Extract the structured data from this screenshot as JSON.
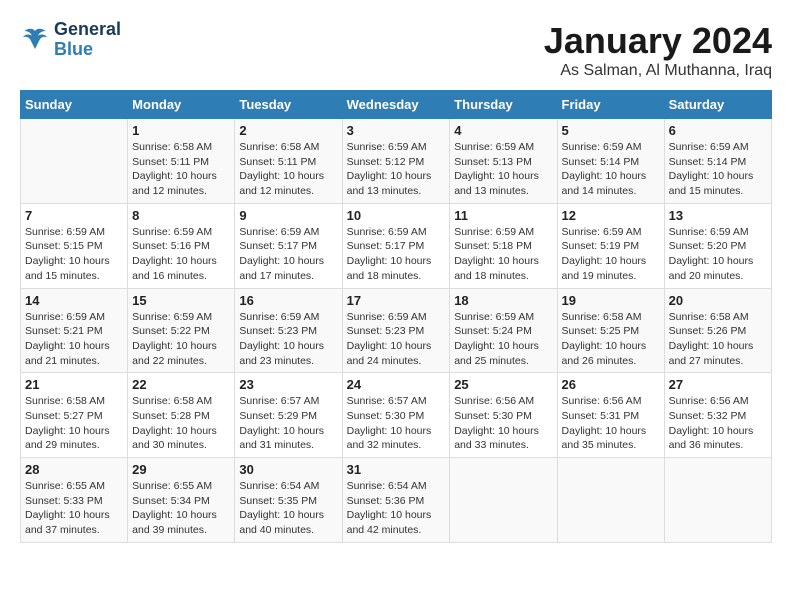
{
  "header": {
    "logo_line1": "General",
    "logo_line2": "Blue",
    "month": "January 2024",
    "location": "As Salman, Al Muthanna, Iraq"
  },
  "weekdays": [
    "Sunday",
    "Monday",
    "Tuesday",
    "Wednesday",
    "Thursday",
    "Friday",
    "Saturday"
  ],
  "weeks": [
    [
      {
        "day": "",
        "info": ""
      },
      {
        "day": "1",
        "info": "Sunrise: 6:58 AM\nSunset: 5:11 PM\nDaylight: 10 hours\nand 12 minutes."
      },
      {
        "day": "2",
        "info": "Sunrise: 6:58 AM\nSunset: 5:11 PM\nDaylight: 10 hours\nand 12 minutes."
      },
      {
        "day": "3",
        "info": "Sunrise: 6:59 AM\nSunset: 5:12 PM\nDaylight: 10 hours\nand 13 minutes."
      },
      {
        "day": "4",
        "info": "Sunrise: 6:59 AM\nSunset: 5:13 PM\nDaylight: 10 hours\nand 13 minutes."
      },
      {
        "day": "5",
        "info": "Sunrise: 6:59 AM\nSunset: 5:14 PM\nDaylight: 10 hours\nand 14 minutes."
      },
      {
        "day": "6",
        "info": "Sunrise: 6:59 AM\nSunset: 5:14 PM\nDaylight: 10 hours\nand 15 minutes."
      }
    ],
    [
      {
        "day": "7",
        "info": "Sunrise: 6:59 AM\nSunset: 5:15 PM\nDaylight: 10 hours\nand 15 minutes."
      },
      {
        "day": "8",
        "info": "Sunrise: 6:59 AM\nSunset: 5:16 PM\nDaylight: 10 hours\nand 16 minutes."
      },
      {
        "day": "9",
        "info": "Sunrise: 6:59 AM\nSunset: 5:17 PM\nDaylight: 10 hours\nand 17 minutes."
      },
      {
        "day": "10",
        "info": "Sunrise: 6:59 AM\nSunset: 5:17 PM\nDaylight: 10 hours\nand 18 minutes."
      },
      {
        "day": "11",
        "info": "Sunrise: 6:59 AM\nSunset: 5:18 PM\nDaylight: 10 hours\nand 18 minutes."
      },
      {
        "day": "12",
        "info": "Sunrise: 6:59 AM\nSunset: 5:19 PM\nDaylight: 10 hours\nand 19 minutes."
      },
      {
        "day": "13",
        "info": "Sunrise: 6:59 AM\nSunset: 5:20 PM\nDaylight: 10 hours\nand 20 minutes."
      }
    ],
    [
      {
        "day": "14",
        "info": "Sunrise: 6:59 AM\nSunset: 5:21 PM\nDaylight: 10 hours\nand 21 minutes."
      },
      {
        "day": "15",
        "info": "Sunrise: 6:59 AM\nSunset: 5:22 PM\nDaylight: 10 hours\nand 22 minutes."
      },
      {
        "day": "16",
        "info": "Sunrise: 6:59 AM\nSunset: 5:23 PM\nDaylight: 10 hours\nand 23 minutes."
      },
      {
        "day": "17",
        "info": "Sunrise: 6:59 AM\nSunset: 5:23 PM\nDaylight: 10 hours\nand 24 minutes."
      },
      {
        "day": "18",
        "info": "Sunrise: 6:59 AM\nSunset: 5:24 PM\nDaylight: 10 hours\nand 25 minutes."
      },
      {
        "day": "19",
        "info": "Sunrise: 6:58 AM\nSunset: 5:25 PM\nDaylight: 10 hours\nand 26 minutes."
      },
      {
        "day": "20",
        "info": "Sunrise: 6:58 AM\nSunset: 5:26 PM\nDaylight: 10 hours\nand 27 minutes."
      }
    ],
    [
      {
        "day": "21",
        "info": "Sunrise: 6:58 AM\nSunset: 5:27 PM\nDaylight: 10 hours\nand 29 minutes."
      },
      {
        "day": "22",
        "info": "Sunrise: 6:58 AM\nSunset: 5:28 PM\nDaylight: 10 hours\nand 30 minutes."
      },
      {
        "day": "23",
        "info": "Sunrise: 6:57 AM\nSunset: 5:29 PM\nDaylight: 10 hours\nand 31 minutes."
      },
      {
        "day": "24",
        "info": "Sunrise: 6:57 AM\nSunset: 5:30 PM\nDaylight: 10 hours\nand 32 minutes."
      },
      {
        "day": "25",
        "info": "Sunrise: 6:56 AM\nSunset: 5:30 PM\nDaylight: 10 hours\nand 33 minutes."
      },
      {
        "day": "26",
        "info": "Sunrise: 6:56 AM\nSunset: 5:31 PM\nDaylight: 10 hours\nand 35 minutes."
      },
      {
        "day": "27",
        "info": "Sunrise: 6:56 AM\nSunset: 5:32 PM\nDaylight: 10 hours\nand 36 minutes."
      }
    ],
    [
      {
        "day": "28",
        "info": "Sunrise: 6:55 AM\nSunset: 5:33 PM\nDaylight: 10 hours\nand 37 minutes."
      },
      {
        "day": "29",
        "info": "Sunrise: 6:55 AM\nSunset: 5:34 PM\nDaylight: 10 hours\nand 39 minutes."
      },
      {
        "day": "30",
        "info": "Sunrise: 6:54 AM\nSunset: 5:35 PM\nDaylight: 10 hours\nand 40 minutes."
      },
      {
        "day": "31",
        "info": "Sunrise: 6:54 AM\nSunset: 5:36 PM\nDaylight: 10 hours\nand 42 minutes."
      },
      {
        "day": "",
        "info": ""
      },
      {
        "day": "",
        "info": ""
      },
      {
        "day": "",
        "info": ""
      }
    ]
  ]
}
